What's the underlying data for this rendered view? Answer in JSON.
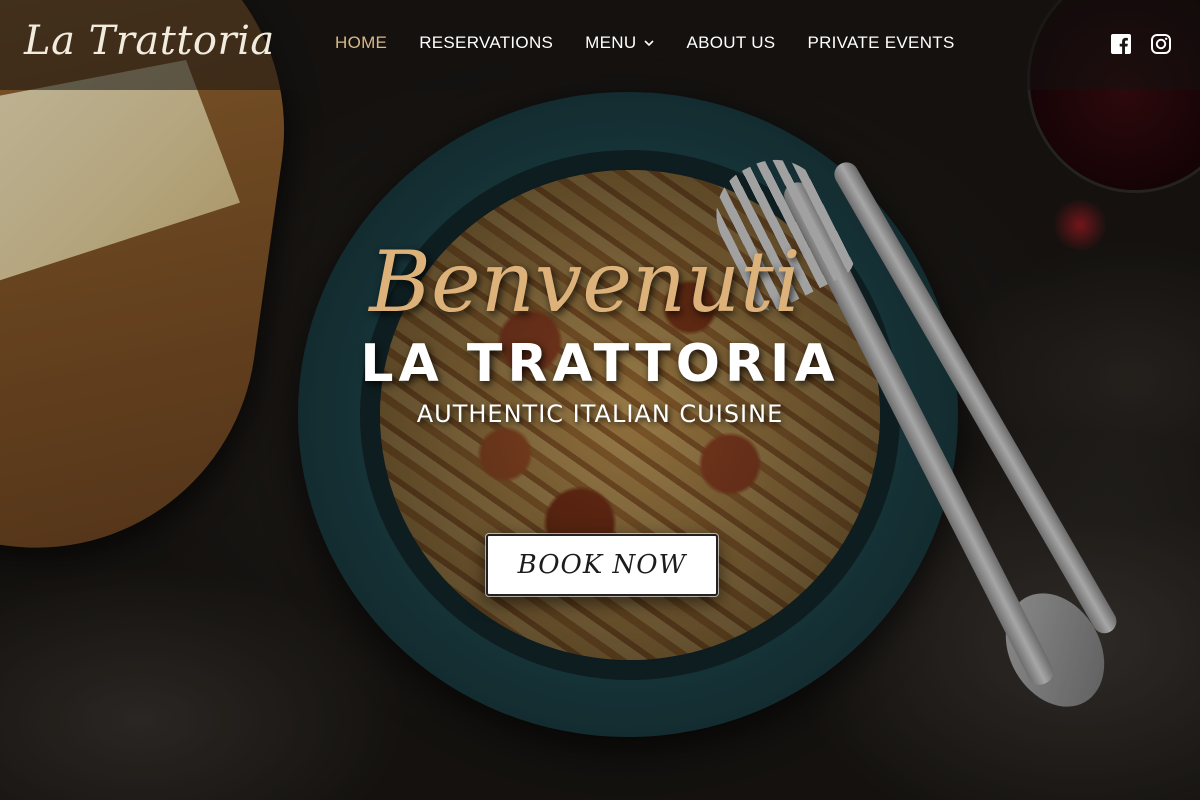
{
  "header": {
    "logo_text": "La Trattoria",
    "nav": [
      {
        "label": "HOME",
        "active": true
      },
      {
        "label": "RESERVATIONS",
        "active": false
      },
      {
        "label": "MENU",
        "active": false,
        "has_dropdown": true
      },
      {
        "label": "ABOUT US",
        "active": false
      },
      {
        "label": "PRIVATE EVENTS",
        "active": false
      }
    ],
    "social": [
      {
        "icon": "facebook-icon"
      },
      {
        "icon": "instagram-icon"
      }
    ]
  },
  "hero": {
    "welcome": "Benvenuti",
    "brand": "LA TRATTORIA",
    "tagline": "AUTHENTIC ITALIAN CUISINE",
    "cta_label": "BOOK NOW"
  },
  "colors": {
    "accent_gold": "#d9b98a",
    "header_bg": "rgba(20,18,16,0.55)",
    "text_white": "#ffffff"
  }
}
